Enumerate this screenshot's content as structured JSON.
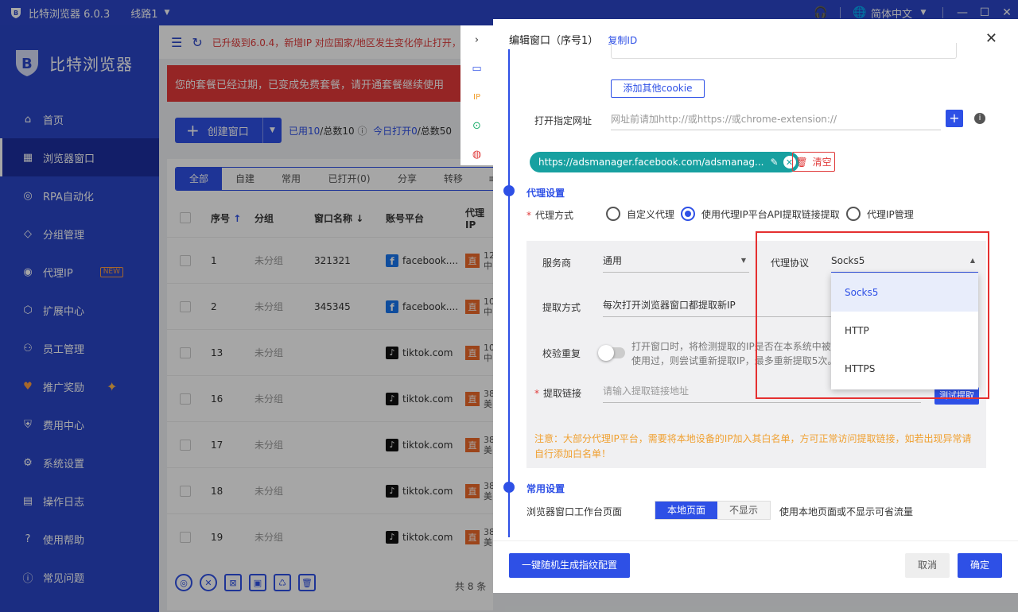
{
  "titlebar": {
    "app_name": "比特浏览器 6.0.3",
    "line": "线路1",
    "language": "简体中文"
  },
  "sidebar": {
    "brand": "比特浏览器",
    "items": [
      {
        "label": "首页",
        "icon": "home-icon"
      },
      {
        "label": "浏览器窗口",
        "icon": "grid-icon"
      },
      {
        "label": "RPA自动化",
        "icon": "robot-icon"
      },
      {
        "label": "分组管理",
        "icon": "cube-icon"
      },
      {
        "label": "代理IP",
        "icon": "location-pin-icon",
        "badge": "NEW"
      },
      {
        "label": "扩展中心",
        "icon": "extension-icon"
      },
      {
        "label": "员工管理",
        "icon": "users-icon"
      },
      {
        "label": "推广奖励",
        "icon": "gift-icon"
      },
      {
        "label": "费用中心",
        "icon": "shield-yen-icon"
      },
      {
        "label": "系统设置",
        "icon": "settings-icon"
      },
      {
        "label": "操作日志",
        "icon": "log-icon"
      },
      {
        "label": "使用帮助",
        "icon": "help-icon"
      },
      {
        "label": "常见问题",
        "icon": "info-icon"
      }
    ]
  },
  "main": {
    "notice": "已升级到6.0.4，新增IP 对应国家/地区发生变化停止打开，",
    "expired": "您的套餐已经过期，已变成免费套餐，请开通套餐继续使用",
    "create_button": "创建窗口",
    "used_label": "已用10",
    "total_label": "/总数10",
    "today_label": "今日打开0",
    "today_total": "/总数50",
    "tabs": [
      "全部",
      "自建",
      "常用",
      "已打开(0)",
      "分享",
      "转移"
    ],
    "columns": [
      "序号",
      "分组",
      "窗口名称",
      "账号平台",
      "代理IP"
    ],
    "rows": [
      {
        "no": "1",
        "group": "未分组",
        "name": "321321",
        "platform": "facebook....",
        "plat": "fb",
        "proxy": "12",
        "proxy2": "中"
      },
      {
        "no": "2",
        "group": "未分组",
        "name": "345345",
        "platform": "facebook....",
        "plat": "fb",
        "proxy": "10",
        "proxy2": "中"
      },
      {
        "no": "13",
        "group": "未分组",
        "name": "",
        "platform": "tiktok.com",
        "plat": "tt",
        "proxy": "10",
        "proxy2": "中"
      },
      {
        "no": "16",
        "group": "未分组",
        "name": "",
        "platform": "tiktok.com",
        "plat": "tt",
        "proxy": "38",
        "proxy2": "美"
      },
      {
        "no": "17",
        "group": "未分组",
        "name": "",
        "platform": "tiktok.com",
        "plat": "tt",
        "proxy": "38",
        "proxy2": "美"
      },
      {
        "no": "18",
        "group": "未分组",
        "name": "",
        "platform": "tiktok.com",
        "plat": "tt",
        "proxy": "38",
        "proxy2": "美"
      },
      {
        "no": "19",
        "group": "未分组",
        "name": "",
        "platform": "tiktok.com",
        "plat": "tt",
        "proxy": "38",
        "proxy2": "美"
      }
    ],
    "direct_label": "直",
    "total_count": "共 8 条"
  },
  "drawer": {
    "title": "编辑窗口（序号1）",
    "copy_id": "复制ID",
    "add_cookie": "添加其他cookie",
    "open_url_label": "打开指定网址",
    "url_placeholder": "网址前请加http://或https://或chrome-extension://",
    "url_tag": "https://adsmanager.facebook.com/adsmanag...",
    "clear": "清空",
    "proxy_section": "代理设置",
    "proxy_mode_label": "代理方式",
    "proxy_modes": [
      "自定义代理",
      "使用代理IP平台API提取链接提取",
      "代理IP管理"
    ],
    "provider_label": "服务商",
    "provider_value": "通用",
    "protocol_label": "代理协议",
    "protocol_value": "Socks5",
    "extract_mode_label": "提取方式",
    "extract_mode_value": "每次打开浏览器窗口都提取新IP",
    "verify_label": "校验重复",
    "verify_desc_1": "打开窗口时，将检测提取的IP是否在本系统中被",
    "verify_desc_2": "使用过，则尝试重新提取IP，最多重新提取5次。",
    "extract_link_label": "提取链接",
    "extract_link_placeholder": "请输入提取链接地址",
    "test_button": "测试提取",
    "warning": "注意：大部分代理IP平台，需要将本地设备的IP加入其白名单，方可正常访问提取链接，如若出现异常请自行添加白名单！",
    "protocol_options": [
      "Socks5",
      "HTTP",
      "HTTPS"
    ],
    "common_section": "常用设置",
    "workbench_label": "浏览器窗口工作台页面",
    "workbench_options": [
      "本地页面",
      "不显示"
    ],
    "workbench_hint": "使用本地页面或不显示可省流量",
    "gen_button": "一键随机生成指纹配置",
    "cancel": "取消",
    "ok": "确定"
  },
  "colors": {
    "primary": "#2e50e6",
    "sidebar": "#2a45c8",
    "danger": "#e53030",
    "warning": "#f0a030",
    "teal": "#17a0a0"
  }
}
